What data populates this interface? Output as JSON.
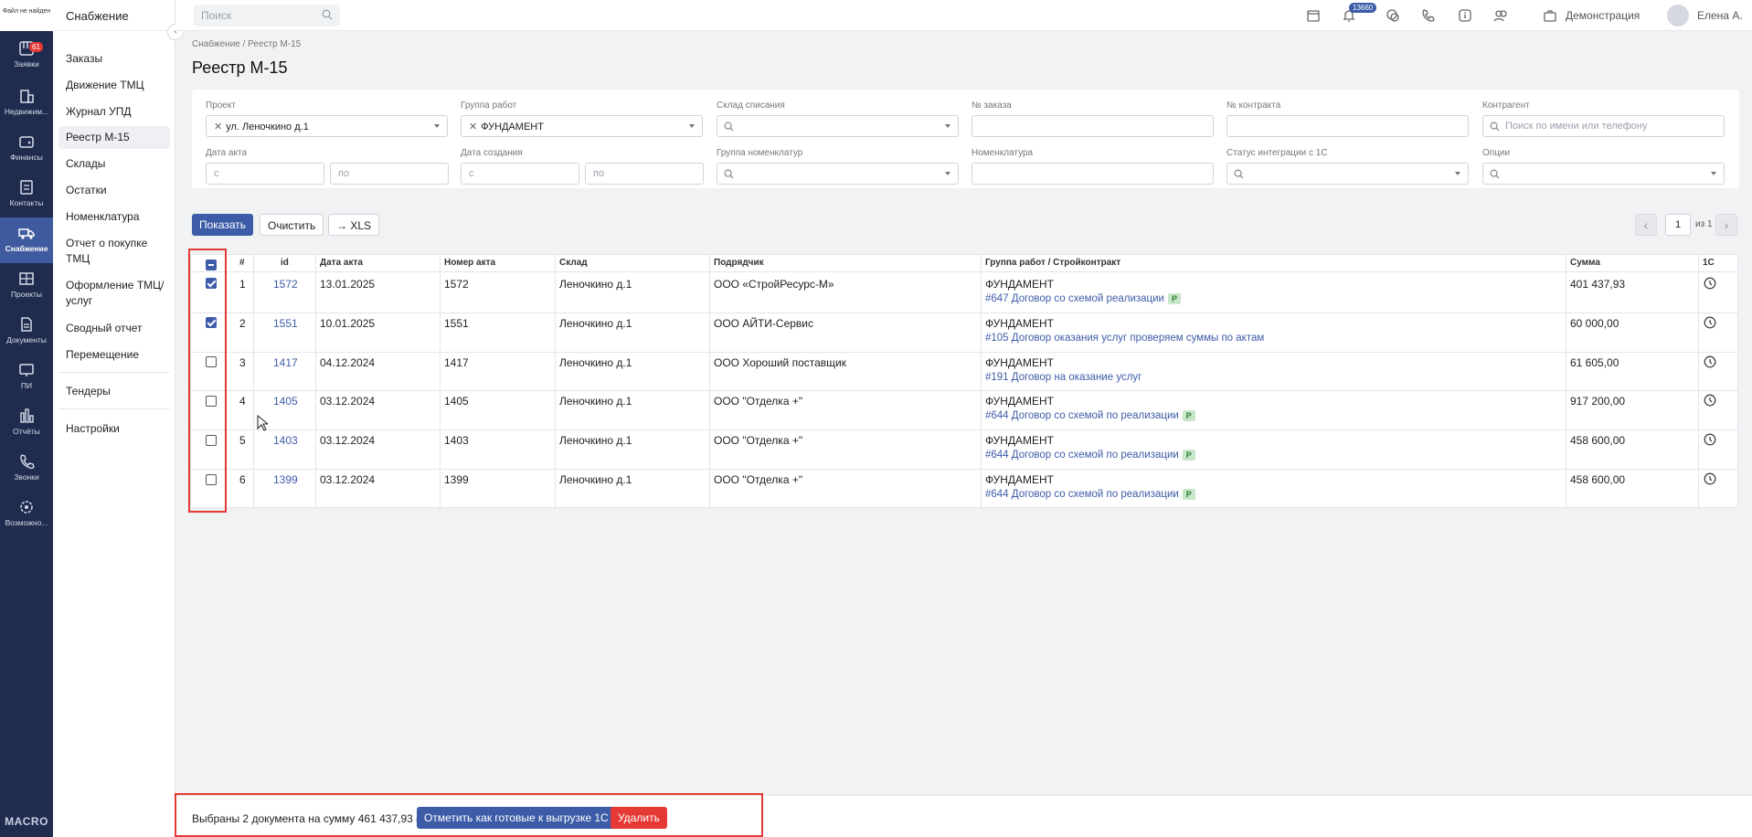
{
  "rail": {
    "logo_text": "Файл не найден",
    "items": [
      {
        "label": "Заявки",
        "badge": "61"
      },
      {
        "label": "Недвижим..."
      },
      {
        "label": "Финансы"
      },
      {
        "label": "Контакты"
      },
      {
        "label": "Снабжение"
      },
      {
        "label": "Проекты"
      },
      {
        "label": "Документы"
      },
      {
        "label": "ПИ"
      },
      {
        "label": "Отчёты"
      },
      {
        "label": "Звонки"
      },
      {
        "label": "Возможно..."
      }
    ],
    "brand": "MACRO"
  },
  "subnav": {
    "title": "Снабжение",
    "items": [
      "Заказы",
      "Движение ТМЦ",
      "Журнал УПД",
      "Реестр М-15",
      "Склады",
      "Остатки",
      "Номенклатура",
      "Отчет о покупке ТМЦ",
      "Оформление ТМЦ/ услуг",
      "Сводный отчет",
      "Перемещение",
      "Тендеры",
      "Настройки"
    ],
    "active_index": 3
  },
  "topbar": {
    "search_placeholder": "Поиск",
    "bell_count": "13660",
    "demo_label": "Демонстрация",
    "user_name": "Елена А."
  },
  "breadcrumb": "Снабжение / Реестр М-15",
  "page_title": "Реестр М-15",
  "filters": {
    "project": {
      "label": "Проект",
      "value": "ул. Леночкино д.1"
    },
    "work_group": {
      "label": "Группа работ",
      "value": "ФУНДАМЕНТ"
    },
    "warehouse": {
      "label": "Склад списания"
    },
    "order_no": {
      "label": "№ заказа"
    },
    "contract_no": {
      "label": "№ контракта"
    },
    "counterparty": {
      "label": "Контрагент",
      "placeholder": "Поиск по имени или телефону"
    },
    "act_date": {
      "label": "Дата акта",
      "from": "с",
      "to": "по"
    },
    "created_date": {
      "label": "Дата создания",
      "from": "с",
      "to": "по"
    },
    "nomenclature_group": {
      "label": "Группа номенклатур"
    },
    "nomenclature": {
      "label": "Номенклатура"
    },
    "integration_status": {
      "label": "Статус интеграции с 1С"
    },
    "options": {
      "label": "Опции"
    }
  },
  "actions": {
    "show": "Показать",
    "clear": "Очистить",
    "xls": "→ XLS"
  },
  "pager": {
    "page": "1",
    "of": "из 1"
  },
  "table": {
    "headers": [
      "#",
      "id",
      "Дата акта",
      "Номер акта",
      "Склад",
      "Подрядчик",
      "Группа работ / Стройконтракт",
      "Сумма",
      "1С"
    ],
    "rows": [
      {
        "num": "1",
        "id": "1572",
        "date": "13.01.2025",
        "act": "1572",
        "warehouse": "Леночкино д.1",
        "contractor": "ООО «СтройРесурс-М»",
        "group": "ФУНДАМЕНТ",
        "contract": "#647 Договор со схемой реализации",
        "badge": "Р",
        "sum": "401 437,93",
        "checked": true
      },
      {
        "num": "2",
        "id": "1551",
        "date": "10.01.2025",
        "act": "1551",
        "warehouse": "Леночкино д.1",
        "contractor": "ООО АЙТИ-Сервис",
        "group": "ФУНДАМЕНТ",
        "contract": "#105 Договор оказания услуг проверяем суммы по актам",
        "badge": "",
        "sum": "60 000,00",
        "checked": true
      },
      {
        "num": "3",
        "id": "1417",
        "date": "04.12.2024",
        "act": "1417",
        "warehouse": "Леночкино д.1",
        "contractor": "ООО Хороший поставщик",
        "group": "ФУНДАМЕНТ",
        "contract": "#191 Договор на оказание услуг",
        "badge": "",
        "sum": "61 605,00",
        "checked": false
      },
      {
        "num": "4",
        "id": "1405",
        "date": "03.12.2024",
        "act": "1405",
        "warehouse": "Леночкино д.1",
        "contractor": "ООО \"Отделка +\"",
        "group": "ФУНДАМЕНТ",
        "contract": "#644 Договор со схемой по реализации",
        "badge": "Р",
        "sum": "917 200,00",
        "checked": false
      },
      {
        "num": "5",
        "id": "1403",
        "date": "03.12.2024",
        "act": "1403",
        "warehouse": "Леночкино д.1",
        "contractor": "ООО \"Отделка +\"",
        "group": "ФУНДАМЕНТ",
        "contract": "#644 Договор со схемой по реализации",
        "badge": "Р",
        "sum": "458 600,00",
        "checked": false
      },
      {
        "num": "6",
        "id": "1399",
        "date": "03.12.2024",
        "act": "1399",
        "warehouse": "Леночкино д.1",
        "contractor": "ООО \"Отделка +\"",
        "group": "ФУНДАМЕНТ",
        "contract": "#644 Договор со схемой по реализации",
        "badge": "Р",
        "sum": "458 600,00",
        "checked": false
      }
    ]
  },
  "bottombar": {
    "summary": "Выбраны 2 документа на сумму 461 437,93 ₽",
    "mark_ready": "Отметить как готовые к выгрузке 1С",
    "delete": "Удалить"
  },
  "colors": {
    "rail": "#1f2c4e",
    "rail_active": "#3f5a9e",
    "primary": "#3d5ca8",
    "danger": "#e53935",
    "badge_green": "#c8e6c9"
  }
}
